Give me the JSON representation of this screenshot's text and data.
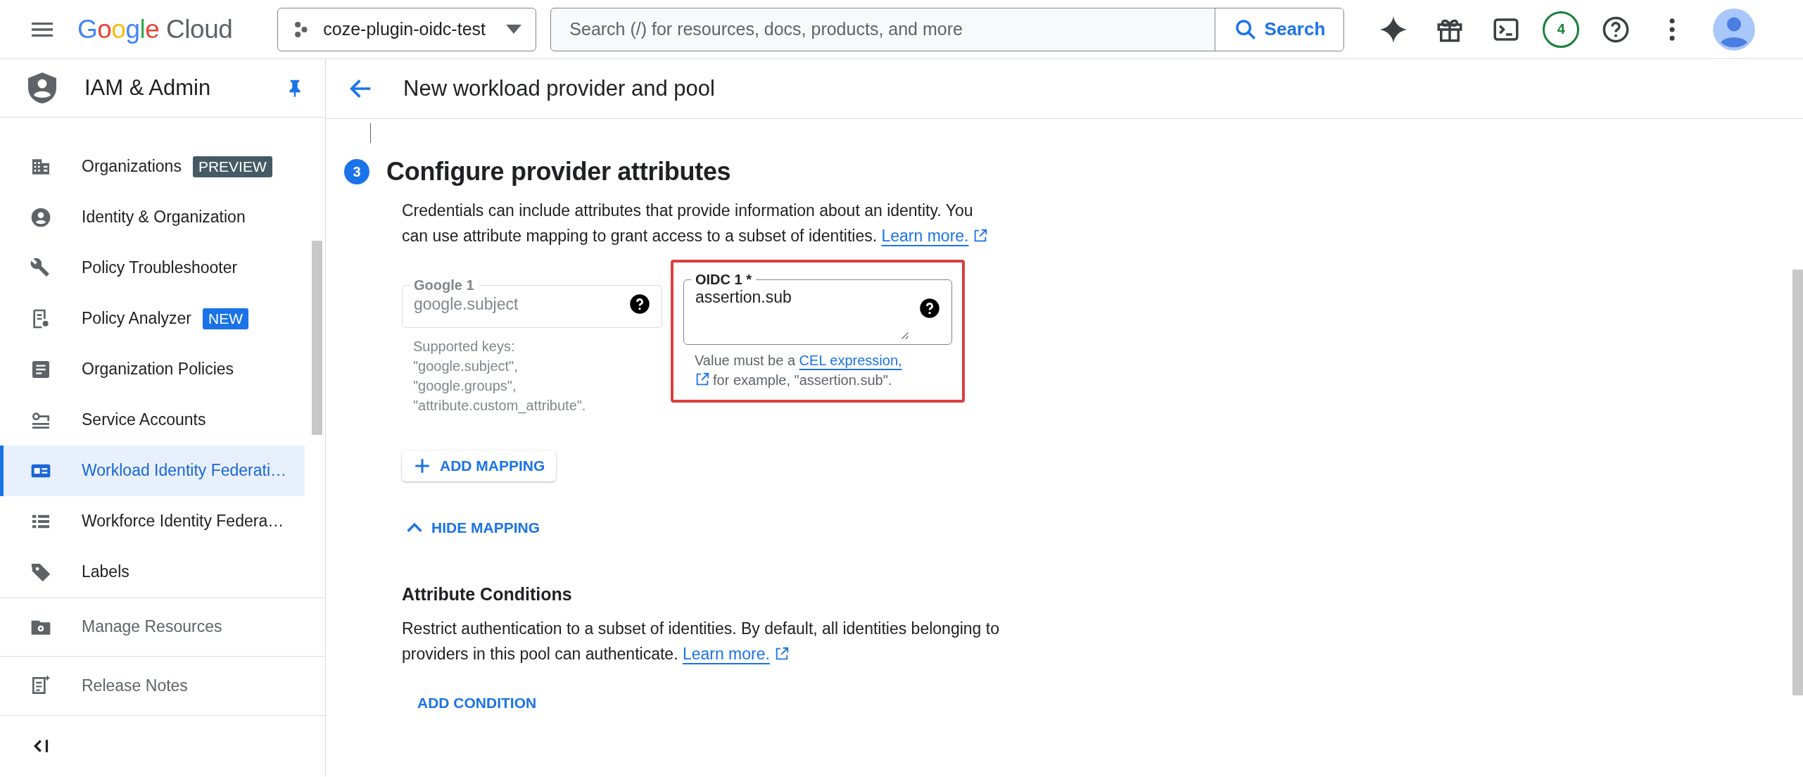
{
  "topbar": {
    "logo": "Google Cloud",
    "project": "coze-plugin-oidc-test",
    "search": {
      "placeholder": "Search (/) for resources, docs, products, and more",
      "button": "Search"
    },
    "notification_count": "4"
  },
  "sidebar": {
    "title": "IAM & Admin",
    "items": [
      {
        "label": "Organizations",
        "selected": false,
        "badge": {
          "text": "PREVIEW",
          "kind": "preview"
        }
      },
      {
        "label": "Identity & Organization",
        "selected": false
      },
      {
        "label": "Policy Troubleshooter",
        "selected": false
      },
      {
        "label": "Policy Analyzer",
        "selected": false,
        "badge": {
          "text": "NEW",
          "kind": "new"
        }
      },
      {
        "label": "Organization Policies",
        "selected": false
      },
      {
        "label": "Service Accounts",
        "selected": false
      },
      {
        "label": "Workload Identity Federati…",
        "selected": true
      },
      {
        "label": "Workforce Identity Federa…",
        "selected": false
      },
      {
        "label": "Labels",
        "selected": false
      }
    ],
    "footer_items": [
      {
        "label": "Manage Resources"
      },
      {
        "label": "Release Notes"
      }
    ]
  },
  "page": {
    "title": "New workload provider and pool"
  },
  "step": {
    "number": "3",
    "title": "Configure provider attributes",
    "description": "Credentials can include attributes that provide information about an identity. You can use attribute mapping to grant access to a subset of identities.",
    "learn_more": "Learn more."
  },
  "mappings": [
    {
      "kind": "readonly",
      "label": "Google 1",
      "value": "google.subject",
      "highlighted": false,
      "helper": "Supported keys:\n\"google.subject\",\n\"google.groups\",\n\"attribute.custom_attribute\"."
    },
    {
      "kind": "input",
      "label": "OIDC 1 *",
      "value": "assertion.sub",
      "highlighted": true,
      "helper_before": "Value must be a ",
      "helper_link": "CEL expression,",
      "helper_after": " for example, \"assertion.sub\"."
    }
  ],
  "add_mapping": "ADD MAPPING",
  "toggle": {
    "label": "HIDE MAPPING",
    "expanded": true
  },
  "conditions": {
    "title": "Attribute Conditions",
    "description": "Restrict authentication to a subset of identities. By default, all identities belonging to providers in this pool can authenticate.",
    "learn_more": "Learn more.",
    "button": "ADD CONDITION"
  }
}
